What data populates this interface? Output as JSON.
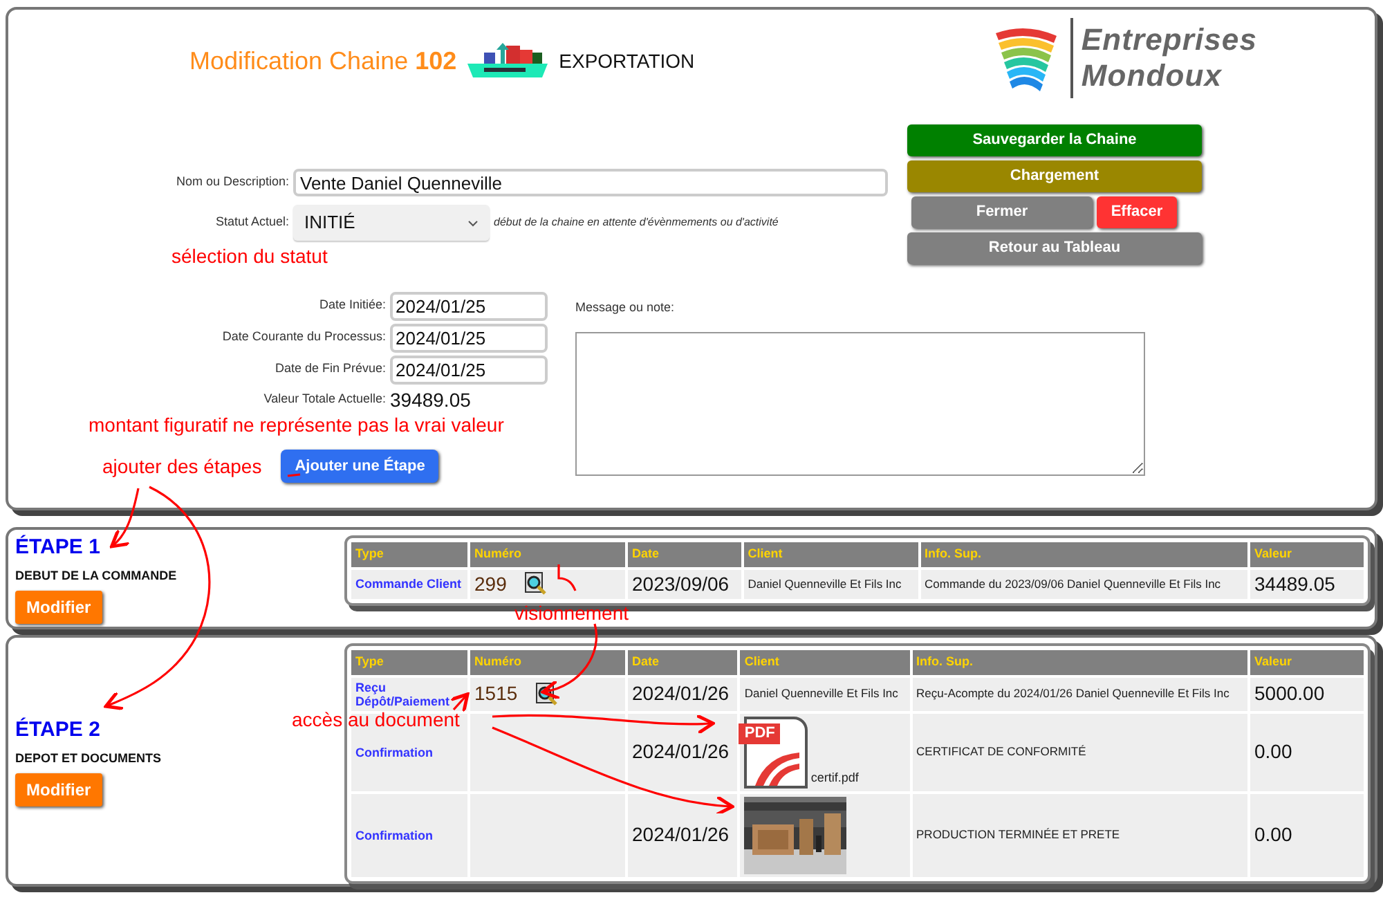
{
  "header": {
    "title": "Modification Chaine",
    "number": "102",
    "category": "EXPORTATION",
    "logo": [
      "Entreprises",
      "Mondoux"
    ]
  },
  "form": {
    "name_label": "Nom ou Description:",
    "name_value": "Vente Daniel Quenneville",
    "status_label": "Statut Actuel:",
    "status_value": "INITIÉ",
    "status_hint": "début de la chaine en attente d'évènmements ou d'activité",
    "dates": [
      {
        "label": "Date Initiée:",
        "value": "2024/01/25"
      },
      {
        "label": "Date Courante du Processus:",
        "value": "2024/01/25"
      },
      {
        "label": "Date de Fin Prévue:",
        "value": "2024/01/25"
      }
    ],
    "total_label": "Valeur Totale Actuelle:",
    "total_value": "39489.05",
    "message_label": "Message ou note:",
    "add_step_button": "Ajouter une Étape"
  },
  "button_rows": [
    [
      {
        "label": "Sauvegarder la Chaine",
        "kind": "save"
      }
    ],
    [
      {
        "label": "Chargement",
        "kind": "load"
      }
    ],
    [
      {
        "label": "Fermer",
        "kind": "close"
      },
      {
        "label": "Effacer",
        "kind": "delete"
      }
    ],
    [
      {
        "label": "Retour au Tableau",
        "kind": "back"
      }
    ]
  ],
  "steps": [
    {
      "title": "ÉTAPE 1",
      "subtitle": "DEBUT DE LA COMMANDE",
      "button": "Modifier",
      "columns": [
        "Type",
        "Numéro",
        "Date",
        "Client",
        "Info. Sup.",
        "Valeur"
      ],
      "rows": [
        {
          "type": "Commande Client",
          "number": "299",
          "date": "2023/09/06",
          "client": {
            "kind": "text",
            "text": "Daniel Quenneville Et Fils Inc"
          },
          "info": "Commande du 2023/09/06 Daniel Quenneville Et Fils Inc",
          "value": "34489.05"
        }
      ]
    },
    {
      "title": "ÉTAPE 2",
      "subtitle": "DEPOT ET DOCUMENTS",
      "button": "Modifier",
      "columns": [
        "Type",
        "Numéro",
        "Date",
        "Client",
        "Info. Sup.",
        "Valeur"
      ],
      "rows": [
        {
          "type": "Reçu Dépôt/Paiement",
          "number": "1515",
          "date": "2024/01/26",
          "client": {
            "kind": "text",
            "text": "Daniel Quenneville Et Fils Inc"
          },
          "info": "Reçu-Acompte du 2024/01/26 Daniel Quenneville Et Fils Inc",
          "value": "5000.00"
        },
        {
          "type": "Confirmation",
          "date": "2024/01/26",
          "client": {
            "kind": "pdf",
            "badge": "PDF",
            "file": "certif.pdf"
          },
          "info": "CERTIFICAT DE CONFORMITÉ",
          "value": "0.00"
        },
        {
          "type": "Confirmation",
          "date": "2024/01/26",
          "info": "PRODUCTION TERMINÉE ET PRETE",
          "value": "0.00"
        }
      ]
    }
  ],
  "annotations": {
    "status": "sélection du statut",
    "amount": "montant figuratif ne représente pas la vrai valeur",
    "add_steps": "ajouter des étapes",
    "viewing": "visionnement",
    "document_access": "accès au document"
  }
}
